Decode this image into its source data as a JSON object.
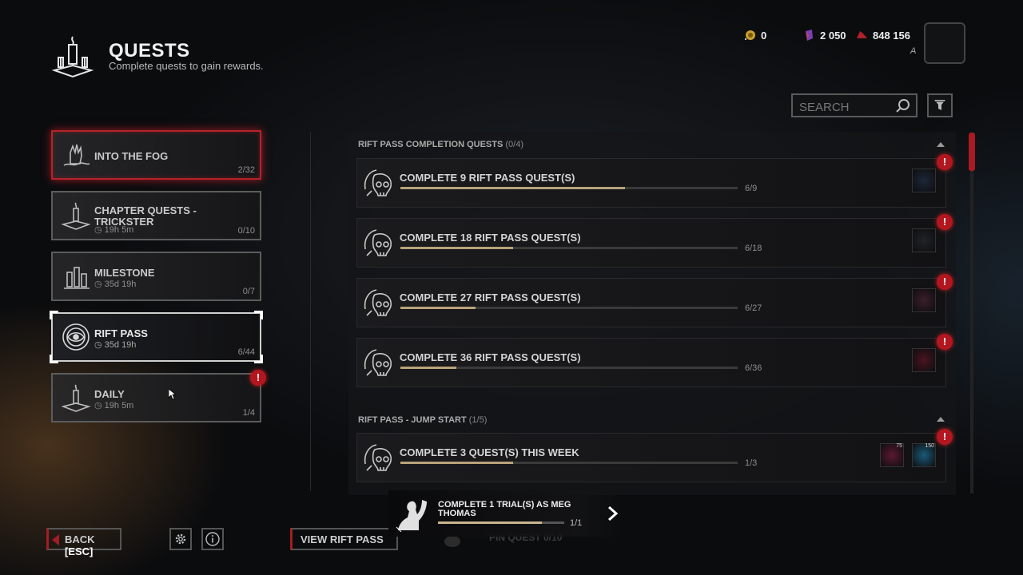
{
  "header": {
    "title": "QUESTS",
    "subtitle": "Complete quests to gain rewards.",
    "emblem_icon": "candle-altar-icon"
  },
  "currencies": [
    {
      "name": "bloodpoints-shards",
      "icon": "coin-sparkle-icon",
      "value": "0"
    },
    {
      "name": "auric-cells",
      "icon": "purple-crystal-icon",
      "value": "2 050"
    },
    {
      "name": "bloodpoints",
      "icon": "red-drop-icon",
      "value": "848 156"
    }
  ],
  "player": {
    "letter": "A"
  },
  "search": {
    "placeholder": "SEARCH"
  },
  "categories": [
    {
      "name": "INTO THE FOG",
      "time": "",
      "count": "2/32",
      "icon": "hand-in-fog-icon",
      "state": "hovered-red"
    },
    {
      "name": "CHAPTER QUESTS - TRICKSTER",
      "time": "19h 5m",
      "count": "0/10",
      "icon": "candle-altar-icon",
      "state": "normal"
    },
    {
      "name": "MILESTONE",
      "time": "35d 19h",
      "count": "0/7",
      "icon": "candles-icon",
      "state": "normal"
    },
    {
      "name": "RIFT PASS",
      "time": "35d 19h",
      "count": "6/44",
      "icon": "rift-eye-icon",
      "state": "selected"
    },
    {
      "name": "DAILY",
      "time": "19h 5m",
      "count": "1/4",
      "icon": "candle-altar-icon",
      "state": "alert",
      "alert": "!"
    }
  ],
  "sections": [
    {
      "title": "RIFT PASS COMPLETION QUESTS",
      "count": "(0/4)",
      "quests": [
        {
          "title": "COMPLETE 9 RIFT PASS QUEST(S)",
          "progress": "6/9",
          "fraction": 0.667,
          "alert": "!",
          "reward_colors": [
            "#1c2838"
          ]
        },
        {
          "title": "COMPLETE 18 RIFT PASS QUEST(S)",
          "progress": "6/18",
          "fraction": 0.333,
          "alert": "!",
          "reward_colors": [
            "#202428"
          ]
        },
        {
          "title": "COMPLETE 27 RIFT PASS QUEST(S)",
          "progress": "6/27",
          "fraction": 0.222,
          "alert": "!",
          "reward_colors": [
            "#3a1e2a"
          ]
        },
        {
          "title": "COMPLETE 36 RIFT PASS QUEST(S)",
          "progress": "6/36",
          "fraction": 0.167,
          "alert": "!",
          "reward_colors": [
            "#4a1420"
          ]
        }
      ]
    },
    {
      "title": "RIFT PASS - JUMP START",
      "count": "(1/5)",
      "quests": [
        {
          "title": "COMPLETE 3 QUEST(S) THIS WEEK",
          "progress": "1/3",
          "fraction": 0.333,
          "alert": "!",
          "reward_colors": [
            "#5a1830",
            "#1a5a78"
          ],
          "reward_numbers": [
            "75",
            "150"
          ]
        }
      ]
    }
  ],
  "tracked_quest": {
    "title": "COMPLETE 1 TRIAL(S) AS MEG THOMAS",
    "progress": "1/1",
    "fraction": 0.82,
    "icon": "survivor-fist-icon"
  },
  "footer": {
    "back_label": "BACK",
    "back_key": "[ESC]",
    "settings_icon": "gear-icon",
    "info_icon": "info-icon",
    "view_rift_label": "VIEW RIFT PASS",
    "pin_quest_label": "PIN QUEST 0/10"
  },
  "colors": {
    "accent_red": "#b3161e",
    "progress_fill": "#b9a37b",
    "selected_border": "#d0d0d0"
  }
}
